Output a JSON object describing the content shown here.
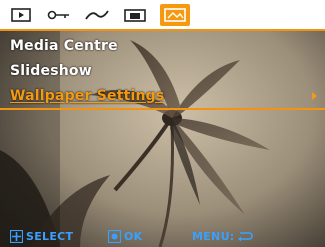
{
  "tabs": [
    {
      "icon": "playback-icon"
    },
    {
      "icon": "key-icon"
    },
    {
      "icon": "curve-icon"
    },
    {
      "icon": "print-icon"
    },
    {
      "icon": "wallpaper-icon",
      "active": true
    }
  ],
  "menu": {
    "items": [
      {
        "label": "Media Centre"
      },
      {
        "label": "Slideshow"
      },
      {
        "label": "Wallpaper Settings",
        "selected": true
      }
    ]
  },
  "footer": {
    "select_label": "SELECT",
    "ok_label": "OK",
    "menu_label": "MENU:"
  },
  "colors": {
    "accent": "#f59a10",
    "hint": "#3aa0ff"
  }
}
